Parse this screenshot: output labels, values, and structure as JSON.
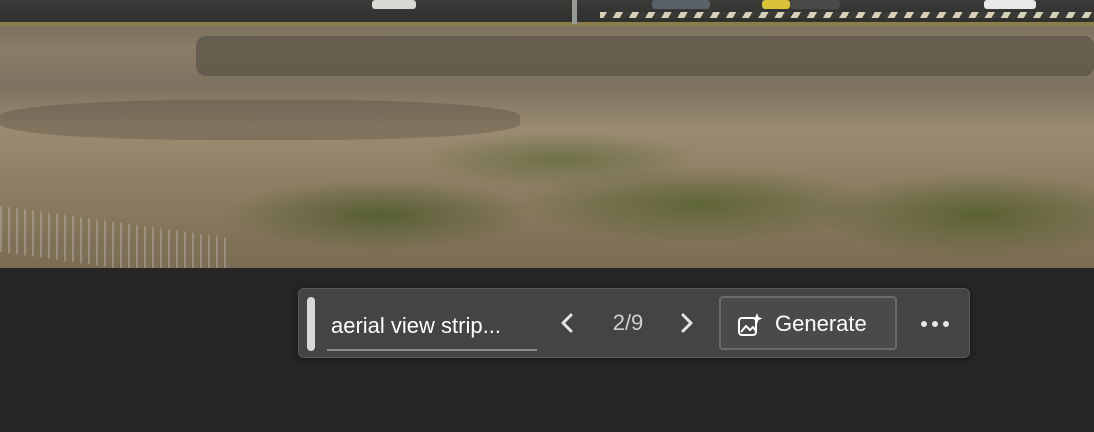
{
  "background_image": {
    "description_icon": "aerial-photo"
  },
  "toolbar": {
    "prompt_text": "aerial view strip...",
    "prev_icon": "chevron-left-icon",
    "next_icon": "chevron-right-icon",
    "counter": "2/9",
    "generate_label": "Generate",
    "generate_icon": "sparkle-image-icon",
    "more_icon": "more-horizontal-icon"
  },
  "colors": {
    "toolbar_bg": "#444444",
    "page_bg": "#262626",
    "text": "#ffffff"
  }
}
